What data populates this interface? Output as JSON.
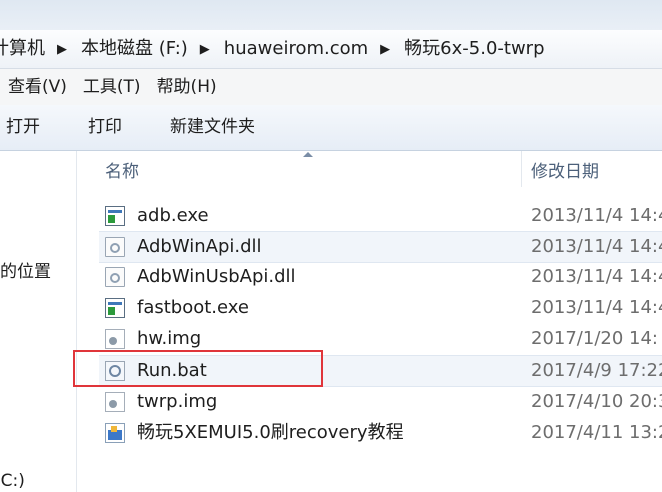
{
  "address": {
    "crumbs": [
      "计算机",
      "本地磁盘 (F:)",
      "huaweirom.com",
      "畅玩6x-5.0-twrp"
    ]
  },
  "menu": {
    "items": [
      "查看(V)",
      "工具(T)",
      "帮助(H)"
    ]
  },
  "toolbar": {
    "open_label": "打开",
    "print_label": "打印",
    "new_folder_label": "新建文件夹"
  },
  "nav": {
    "items": [
      "的位置",
      "(C:)"
    ]
  },
  "columns": {
    "name": "名称",
    "modified": "修改日期"
  },
  "files": [
    {
      "name": "adb.exe",
      "date": "2013/11/4 14:4",
      "icon": "exe-icon"
    },
    {
      "name": "AdbWinApi.dll",
      "date": "2013/11/4 14:4",
      "icon": "dll-icon"
    },
    {
      "name": "AdbWinUsbApi.dll",
      "date": "2013/11/4 14:4",
      "icon": "dll-icon"
    },
    {
      "name": "fastboot.exe",
      "date": "2013/11/4 14:4",
      "icon": "exe-icon"
    },
    {
      "name": "hw.img",
      "date": "2017/1/20 14:",
      "icon": "img-file-icon"
    },
    {
      "name": "Run.bat",
      "date": "2017/4/9 17:22",
      "icon": "bat-file-icon"
    },
    {
      "name": "twrp.img",
      "date": "2017/4/10 20:3",
      "icon": "img-file-icon"
    },
    {
      "name": "畅玩5XEMUI5.0刷recovery教程",
      "date": "2017/4/11 13:2",
      "icon": "document-icon"
    }
  ],
  "selected_file": "Run.bat",
  "colors": {
    "highlight_border": "#e0353a",
    "column_header_text": "#4c607a"
  }
}
